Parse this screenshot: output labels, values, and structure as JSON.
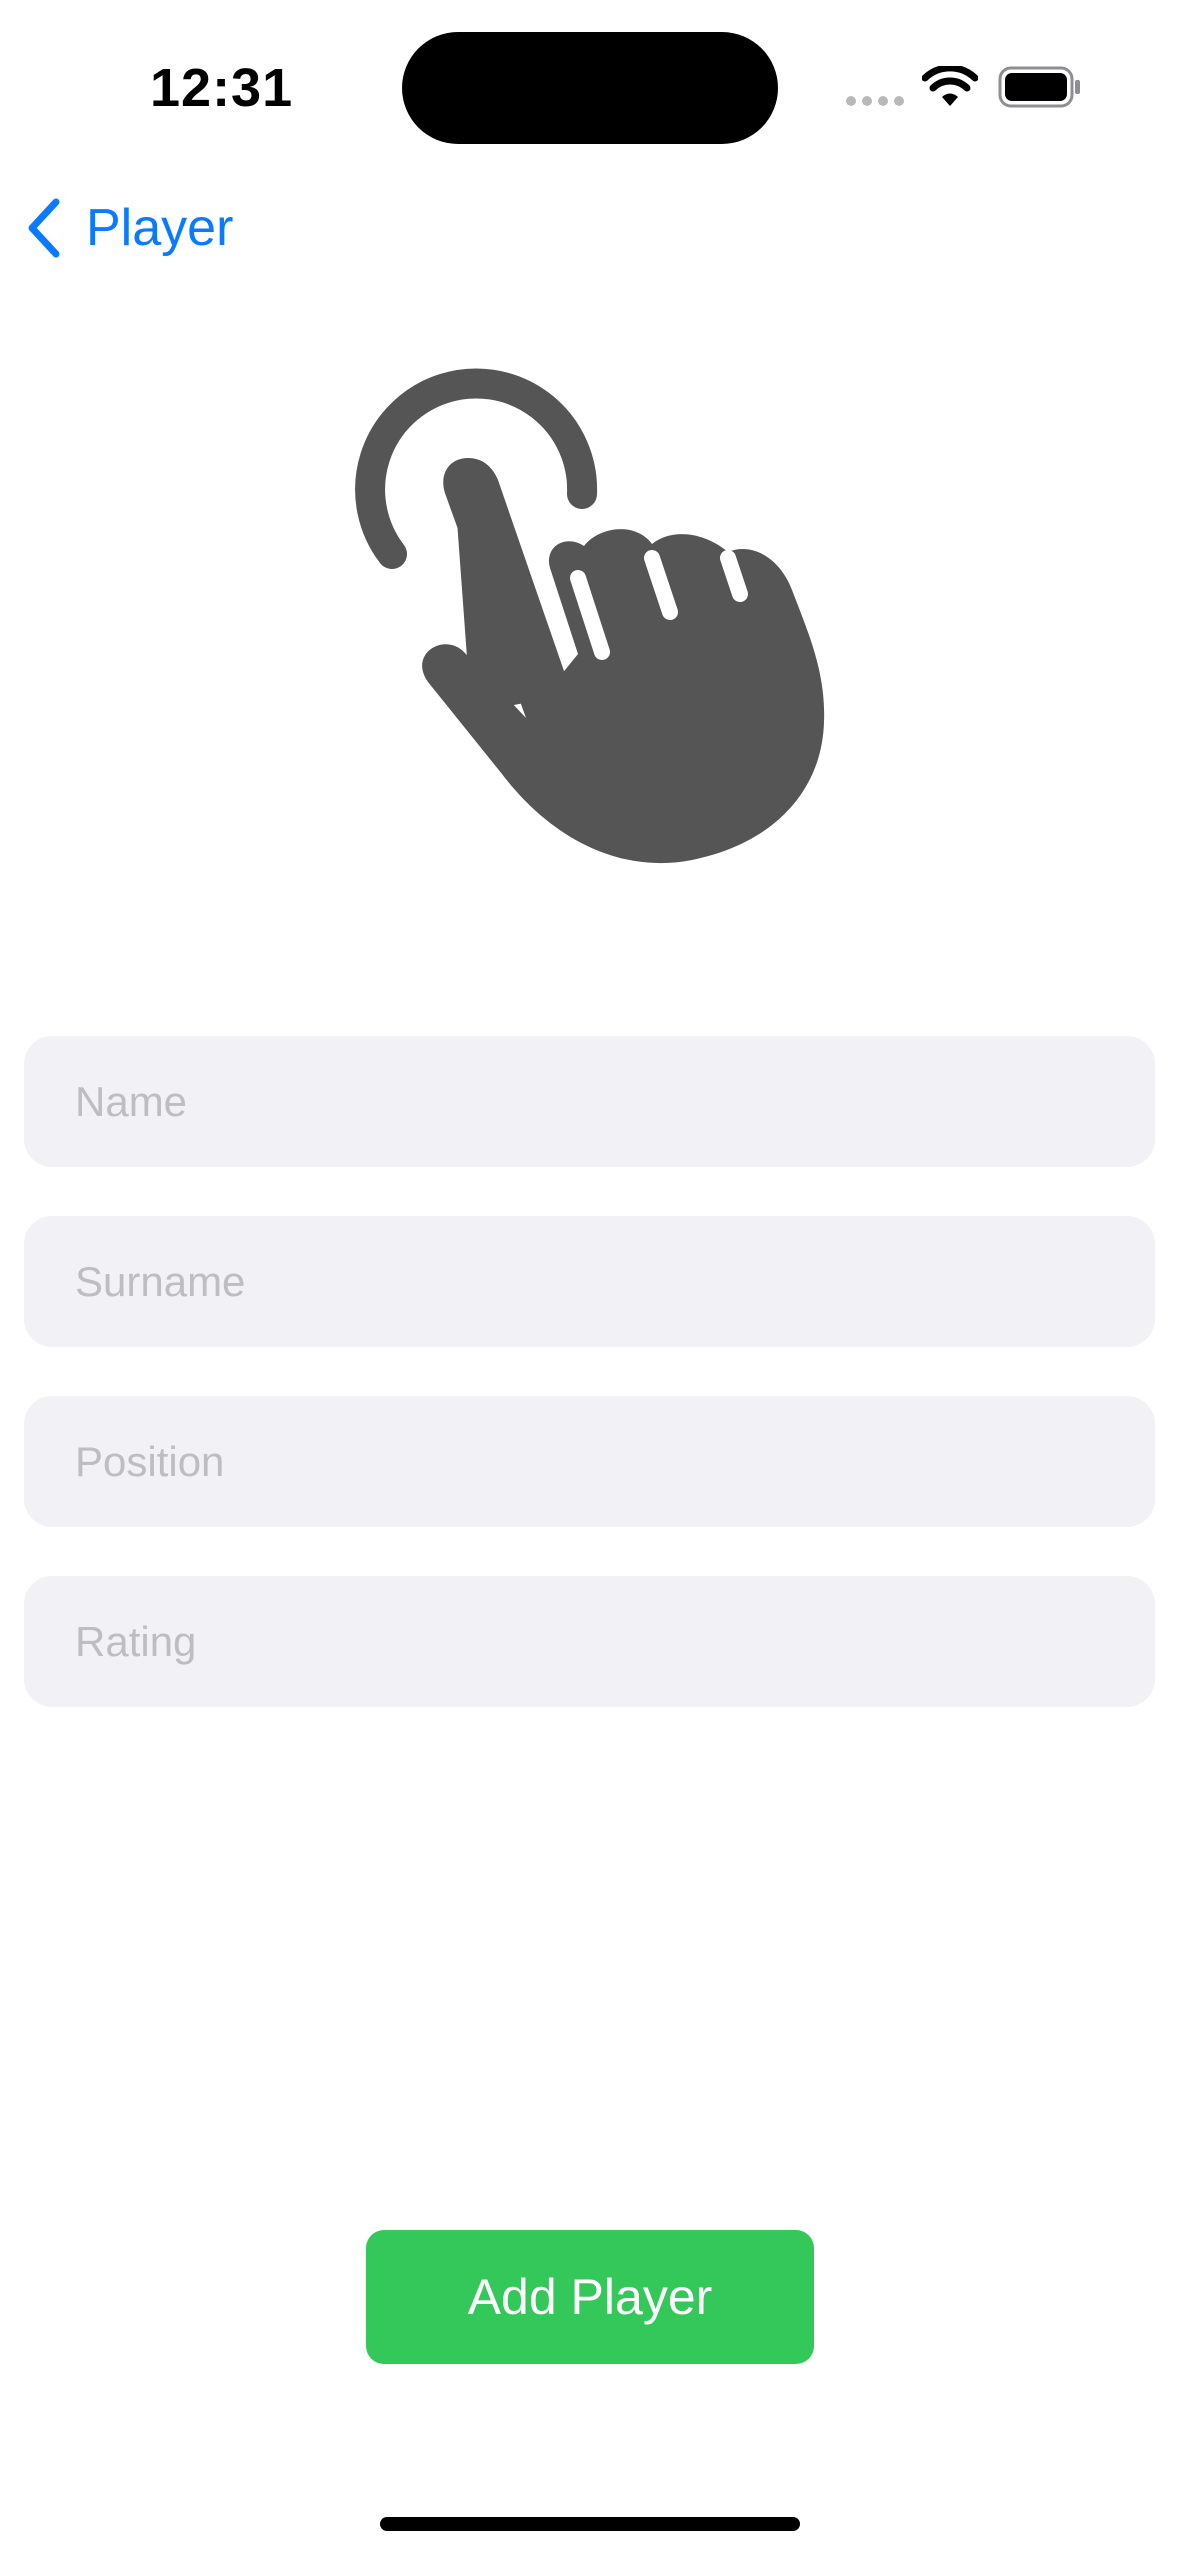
{
  "status_bar": {
    "time": "12:31",
    "icons": [
      "signal-icon",
      "wifi-icon",
      "battery-icon"
    ]
  },
  "nav": {
    "back_label": "Player",
    "back_icon": "chevron-left-icon",
    "accent_color": "#0A7AFF"
  },
  "hero": {
    "icon": "hand-tap-icon",
    "color": "#555555"
  },
  "form": {
    "name_placeholder": "Name",
    "surname_placeholder": "Surname",
    "position_placeholder": "Position",
    "rating_placeholder": "Rating",
    "name_value": "",
    "surname_value": "",
    "position_value": "",
    "rating_value": ""
  },
  "actions": {
    "add_label": "Add Player",
    "add_color": "#34C759"
  }
}
